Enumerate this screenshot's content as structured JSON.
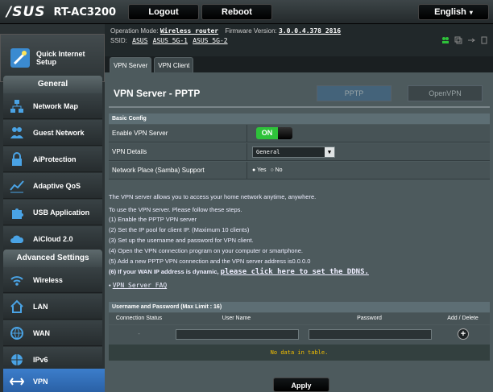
{
  "header": {
    "brand": "/SUS",
    "model": "RT-AC3200",
    "logout_label": "Logout",
    "reboot_label": "Reboot",
    "language": "English"
  },
  "info": {
    "operation_mode_label": "Operation Mode:",
    "operation_mode_value": "Wireless router",
    "firmware_label": "Firmware Version:",
    "firmware_value": "3.0.0.4.378_2816",
    "ssid_label": "SSID:",
    "ssids": [
      "ASUS",
      "ASUS_5G-1",
      "ASUS_5G-2"
    ]
  },
  "sidebar": {
    "quick_setup": "Quick Internet Setup",
    "general_title": "General",
    "general_items": [
      {
        "label": "Network Map",
        "icon": "network-map-icon"
      },
      {
        "label": "Guest Network",
        "icon": "guest-network-icon"
      },
      {
        "label": "AiProtection",
        "icon": "lock-icon"
      },
      {
        "label": "Adaptive QoS",
        "icon": "qos-icon"
      },
      {
        "label": "USB Application",
        "icon": "puzzle-icon"
      },
      {
        "label": "AiCloud 2.0",
        "icon": "cloud-icon"
      }
    ],
    "advanced_title": "Advanced Settings",
    "advanced_items": [
      {
        "label": "Wireless",
        "icon": "wifi-icon"
      },
      {
        "label": "LAN",
        "icon": "home-icon"
      },
      {
        "label": "WAN",
        "icon": "globe-icon"
      },
      {
        "label": "IPv6",
        "icon": "ipv6-globe-icon"
      },
      {
        "label": "VPN",
        "icon": "vpn-icon",
        "active": true
      }
    ]
  },
  "tabs": [
    {
      "label": "VPN Server",
      "active": true
    },
    {
      "label": "VPN Client",
      "active": false
    }
  ],
  "panel": {
    "title": "VPN Server - PPTP",
    "protocol_options": [
      "PPTP",
      "OpenVPN"
    ],
    "basic_config_title": "Basic Config",
    "enable_label": "Enable VPN Server",
    "enable_state": "ON",
    "details_label": "VPN Details",
    "details_value": "General",
    "samba_label": "Network Place (Samba) Support",
    "samba_yes": "Yes",
    "samba_no": "No",
    "samba_selected": "Yes",
    "intro": "The VPN server allows you to access your home network anytime, anywhere.",
    "steps_intro": "To use the VPN server. Please follow these steps.",
    "steps": [
      "(1) Enable the PPTP VPN server",
      "(2) Set the IP pool for client IP. (Maximum 10 clients)",
      "(3) Set up the username and password for VPN client.",
      "(4) Open the VPN connection program on your computer or smartphone.",
      "(5) Add a new PPTP VPN connection and the VPN server address is0.0.0.0"
    ],
    "ddns_prefix": "(6) If your WAN IP address is dynamic,",
    "ddns_link": "please click here to set the DDNS.",
    "faq_link": "VPN Server FAQ",
    "users_title": "Username and Password (Max Limit : 16)",
    "users_columns": [
      "Connection Status",
      "User Name",
      "Password",
      "Add / Delete"
    ],
    "users_placeholder_status": "-",
    "no_data": "No data in table.",
    "apply_label": "Apply"
  },
  "colors": {
    "accent": "#3c7ecb",
    "toggle_on": "#2ec23a",
    "no_data_text": "#f5c000"
  }
}
